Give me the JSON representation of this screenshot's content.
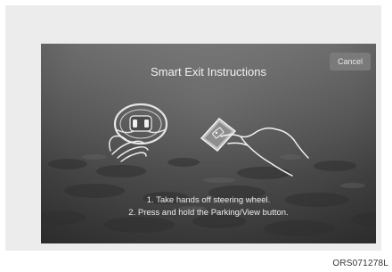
{
  "dialog": {
    "title": "Smart Exit Instructions",
    "cancel_label": "Cancel",
    "instructions": [
      "1. Take hands off steering wheel.",
      "2. Press and hold the Parking/View button."
    ]
  },
  "illustration": {
    "left_icon": "steering-wheel-icon",
    "right_icon": "parking-view-button-icon",
    "hand_icon": "hand-icon"
  },
  "figure_code": "ORS071278L",
  "colors": {
    "screen_top": "#6e6e6e",
    "screen_bottom": "#3a3a3a",
    "text": "#f2f2f2",
    "button_bg": "#7a7a7a"
  }
}
